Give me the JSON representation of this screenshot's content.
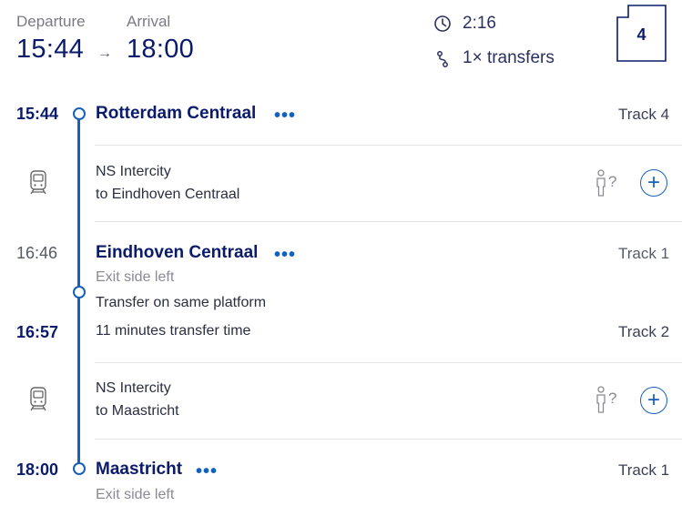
{
  "header": {
    "departure_label": "Departure",
    "arrival_label": "Arrival",
    "departure_time": "15:44",
    "arrow": "→",
    "arrival_time": "18:00",
    "duration": "2:16",
    "transfers": "1× transfers",
    "platform_badge": "4"
  },
  "legs": [
    {
      "time": "15:44",
      "station": "Rotterdam Centraal",
      "more": "•••",
      "track": "Track 4"
    },
    {
      "train_name": "NS Intercity",
      "train_dest": "to Eindhoven Centraal",
      "crowd": "?",
      "add": "+"
    },
    {
      "arr_time": "16:46",
      "station": "Eindhoven Centraal",
      "more": "•••",
      "arr_track": "Track 1",
      "exit": "Exit side left",
      "transfer_note": "Transfer on same platform",
      "dep_time": "16:57",
      "transfer_time": "11 minutes transfer time",
      "dep_track": "Track 2"
    },
    {
      "train_name": "NS Intercity",
      "train_dest": "to Maastricht",
      "crowd": "?",
      "add": "+"
    },
    {
      "time": "18:00",
      "station": "Maastricht",
      "more": "•••",
      "track": "Track 1",
      "exit": "Exit side left"
    }
  ],
  "colors": {
    "accent": "#1560bd",
    "navy": "#0b1b6b"
  },
  "icons": [
    "clock-icon",
    "transfer-icon",
    "platform-badge-icon",
    "train-icon",
    "person-icon",
    "plus-icon"
  ]
}
